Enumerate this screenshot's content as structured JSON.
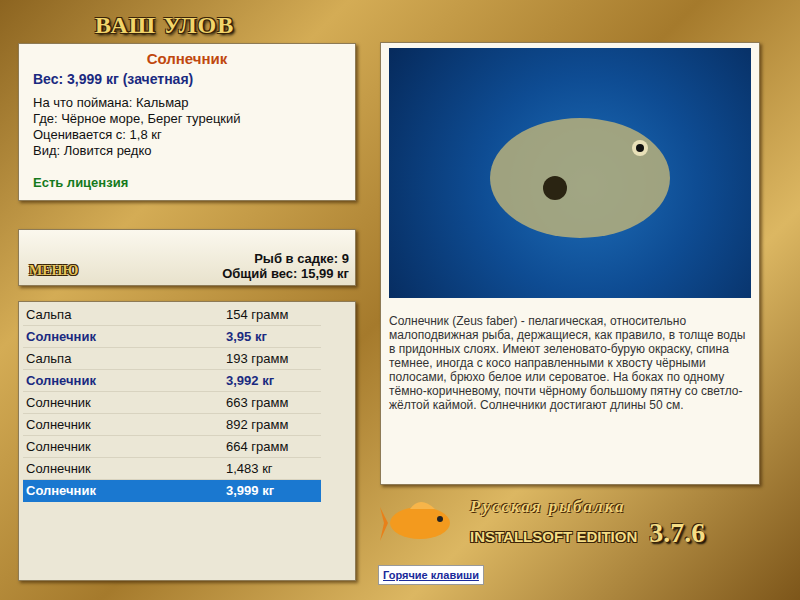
{
  "header": {
    "title": "ВАШ УЛОВ"
  },
  "catch": {
    "name": "Солнечник",
    "weight": "Вес: 3,999 кг (зачетная)",
    "details": [
      "На что поймана: Кальмар",
      "Где: Чёрное море, Берег турецкий",
      "Оценивается с: 1,8 кг",
      "Вид: Ловится редко"
    ],
    "license": "Есть лицензия"
  },
  "menu": {
    "button": "МЕНЮ",
    "count": "Рыб в садке: 9",
    "total": "Общий вес: 15,99 кг"
  },
  "fish_list": [
    {
      "name": "Сальпа",
      "weight": "154 грамм",
      "trophy": false,
      "selected": false
    },
    {
      "name": "Солнечник",
      "weight": "3,95 кг",
      "trophy": true,
      "selected": false
    },
    {
      "name": "Сальпа",
      "weight": "193 грамм",
      "trophy": false,
      "selected": false
    },
    {
      "name": "Солнечник",
      "weight": "3,992 кг",
      "trophy": true,
      "selected": false
    },
    {
      "name": "Солнечник",
      "weight": "663 грамм",
      "trophy": false,
      "selected": false
    },
    {
      "name": "Солнечник",
      "weight": "892 грамм",
      "trophy": false,
      "selected": false
    },
    {
      "name": "Солнечник",
      "weight": "664 грамм",
      "trophy": false,
      "selected": false
    },
    {
      "name": "Солнечник",
      "weight": "1,483 кг",
      "trophy": false,
      "selected": false
    },
    {
      "name": "Солнечник",
      "weight": "3,999 кг",
      "trophy": true,
      "selected": true
    }
  ],
  "description": "Солнечник (Zeus faber) - пелагическая, относительно малоподвижная рыба, держащиеся, как правило, в толще воды в придонных слоях. Имеют зеленовато-бурую окраску, спина темнее, иногда с косо направленными к хвосту чёрными полосами, брюхо белое или сероватое. На боках по одному тёмно-коричневому, почти чёрному большому пятну со светло-жёлтой каймой. Солнечники достигают длины 50 см.",
  "logo": {
    "title": "Русская рыбалка",
    "edition": "INSTALLSOFT EDITION",
    "version": "3.7.6"
  },
  "hotkeys_link": "Горячие клавиши"
}
